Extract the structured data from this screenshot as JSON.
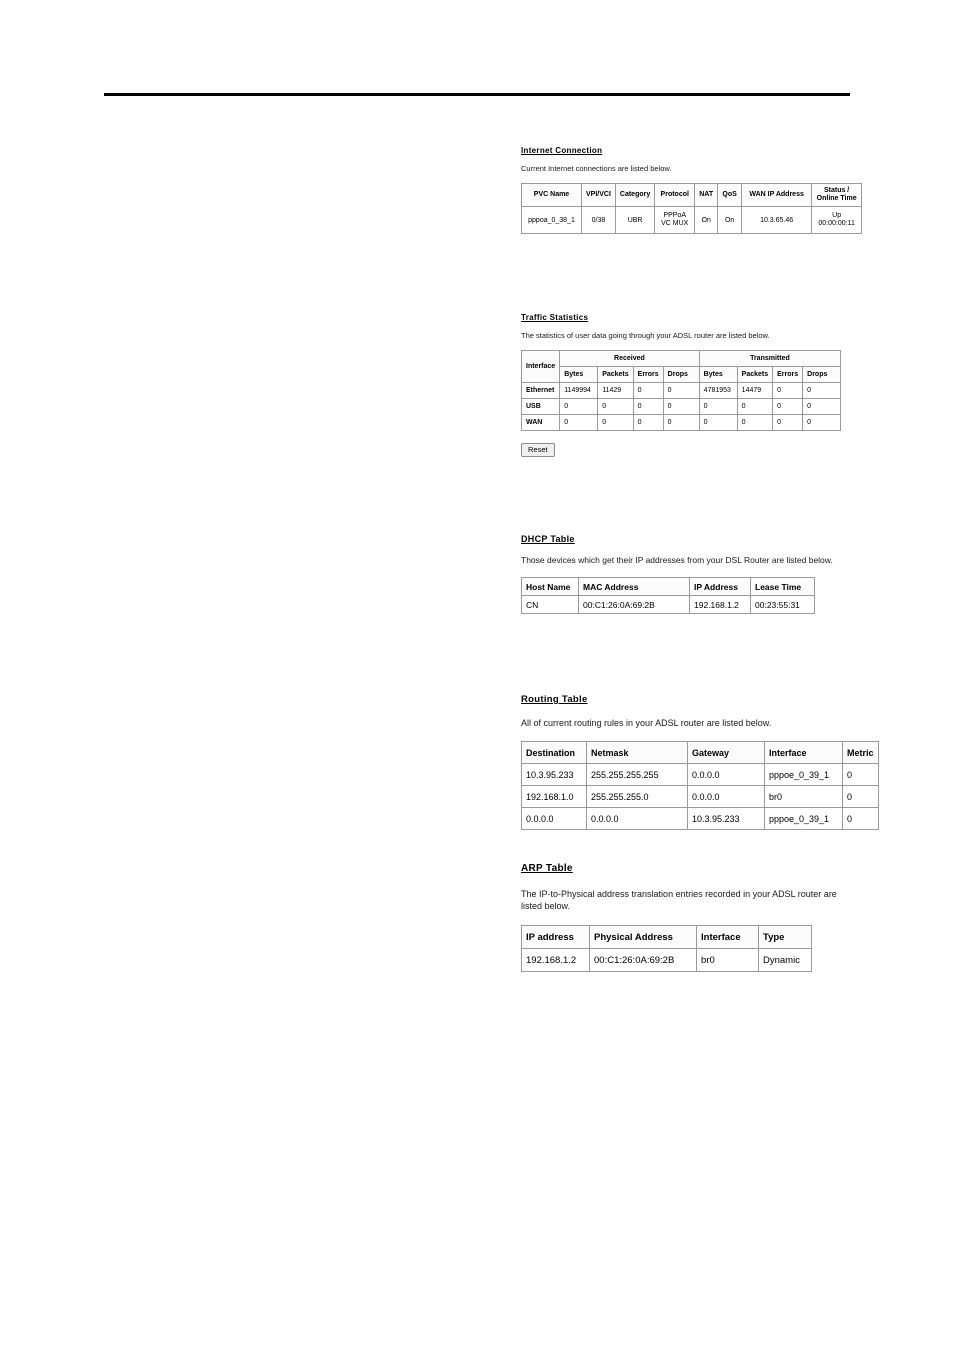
{
  "page": {
    "background_color": "#ffffff",
    "rule_color": "#000000"
  },
  "internet_connection": {
    "heading": "Internet Connection",
    "description": "Current Internet connections are listed below.",
    "columns": [
      "PVC Name",
      "VPI/VCI",
      "Category",
      "Protocol",
      "NAT",
      "QoS",
      "WAN IP Address",
      "Status / Online Time"
    ],
    "column_header_lines": {
      "status": [
        "Status /",
        "Online Time"
      ]
    },
    "rows": [
      {
        "pvc_name": "pppoa_0_38_1",
        "vpi_vci": "0/38",
        "category": "UBR",
        "protocol_line1": "PPPoA",
        "protocol_line2": "VC MUX",
        "nat": "On",
        "qos": "On",
        "wan_ip_address": "10.3.65.46",
        "status_line1": "Up",
        "status_line2": "00:00:00:11"
      }
    ]
  },
  "traffic_statistics": {
    "heading": "Traffic Statistics",
    "description": "The statistics of user data going through your ADSL router are listed below.",
    "group_headers": {
      "interface": "Interface",
      "received": "Received",
      "transmitted": "Transmitted"
    },
    "sub_headers": [
      "Bytes",
      "Packets",
      "Errors",
      "Drops",
      "Bytes",
      "Packets",
      "Errors",
      "Drops"
    ],
    "rows": [
      {
        "interface": "Ethernet",
        "rx_bytes": "1149994",
        "rx_packets": "11429",
        "rx_errors": "0",
        "rx_drops": "0",
        "tx_bytes": "4781953",
        "tx_packets": "14479",
        "tx_errors": "0",
        "tx_drops": "0"
      },
      {
        "interface": "USB",
        "rx_bytes": "0",
        "rx_packets": "0",
        "rx_errors": "0",
        "rx_drops": "0",
        "tx_bytes": "0",
        "tx_packets": "0",
        "tx_errors": "0",
        "tx_drops": "0"
      },
      {
        "interface": "WAN",
        "rx_bytes": "0",
        "rx_packets": "0",
        "rx_errors": "0",
        "rx_drops": "0",
        "tx_bytes": "0",
        "tx_packets": "0",
        "tx_errors": "0",
        "tx_drops": "0"
      }
    ],
    "reset_button_label": "Reset"
  },
  "dhcp_table": {
    "heading": "DHCP Table",
    "description": "Those devices which get their IP addresses from your DSL Router are listed below.",
    "columns": [
      "Host Name",
      "MAC Address",
      "IP Address",
      "Lease Time"
    ],
    "rows": [
      {
        "host_name": "CN",
        "mac_address": "00:C1:26:0A:69:2B",
        "ip_address": "192.168.1.2",
        "lease_time": "00:23:55:31"
      }
    ]
  },
  "routing_table": {
    "heading": "Routing Table",
    "description": "All of current routing rules in your ADSL router are listed below.",
    "columns": [
      "Destination",
      "Netmask",
      "Gateway",
      "Interface",
      "Metric"
    ],
    "rows": [
      {
        "destination": "10.3.95.233",
        "netmask": "255.255.255.255",
        "gateway": "0.0.0.0",
        "interface": "pppoe_0_39_1",
        "metric": "0"
      },
      {
        "destination": "192.168.1.0",
        "netmask": "255.255.255.0",
        "gateway": "0.0.0.0",
        "interface": "br0",
        "metric": "0"
      },
      {
        "destination": "0.0.0.0",
        "netmask": "0.0.0.0",
        "gateway": "10.3.95.233",
        "interface": "pppoe_0_39_1",
        "metric": "0"
      }
    ]
  },
  "arp_table": {
    "heading": "ARP Table",
    "description": "The IP-to-Physical address translation entries recorded in your ADSL router are listed below.",
    "columns": [
      "IP address",
      "Physical Address",
      "Interface",
      "Type"
    ],
    "rows": [
      {
        "ip_address": "192.168.1.2",
        "physical_address": "00:C1:26:0A:69:2B",
        "interface": "br0",
        "type": "Dynamic"
      }
    ]
  }
}
